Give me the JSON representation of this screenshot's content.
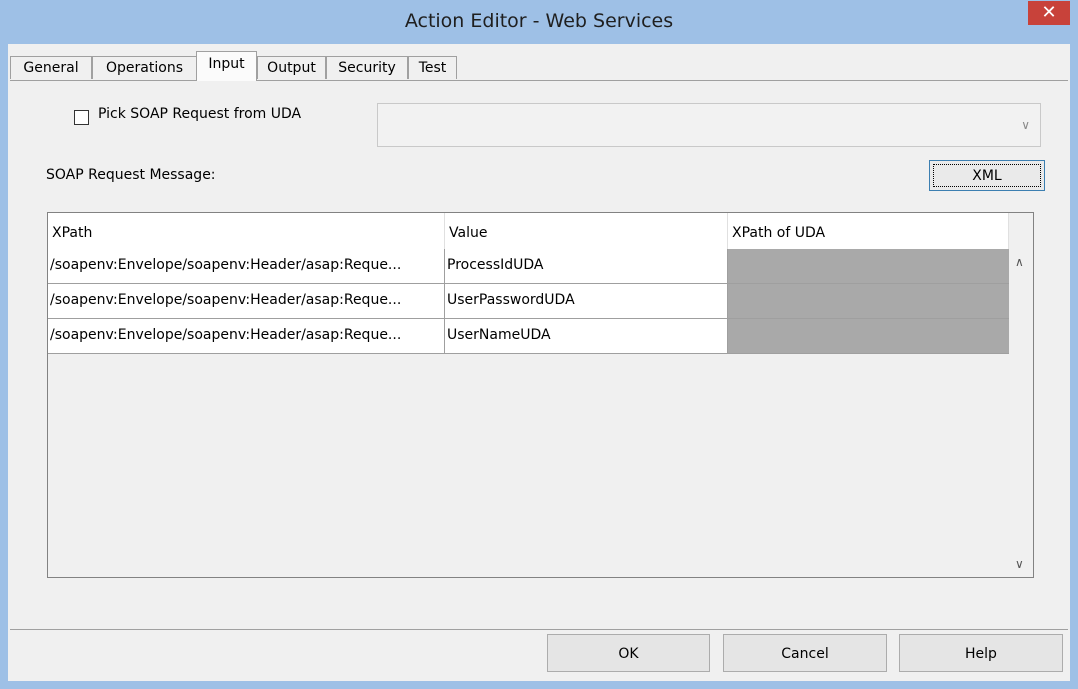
{
  "window": {
    "title": "Action Editor - Web Services",
    "close_glyph": "✕"
  },
  "tabs": [
    {
      "label": "General"
    },
    {
      "label": "Operations"
    },
    {
      "label": "Input"
    },
    {
      "label": "Output"
    },
    {
      "label": "Security"
    },
    {
      "label": "Test"
    }
  ],
  "active_tab": "Input",
  "input": {
    "pick_soap_label": "Pick SOAP Request from UDA",
    "pick_soap_checked": false,
    "uda_select_value": "",
    "soap_message_label": "SOAP Request Message:",
    "xml_button": "XML"
  },
  "grid": {
    "columns": [
      "XPath",
      "Value",
      "XPath of UDA"
    ],
    "rows": [
      {
        "xpath": "/soapenv:Envelope/soapenv:Header/asap:Reque...",
        "value": "ProcessIdUDA",
        "uda": ""
      },
      {
        "xpath": "/soapenv:Envelope/soapenv:Header/asap:Reque...",
        "value": "UserPasswordUDA",
        "uda": ""
      },
      {
        "xpath": "/soapenv:Envelope/soapenv:Header/asap:Reque...",
        "value": "UserNameUDA",
        "uda": ""
      }
    ]
  },
  "buttons": {
    "ok": "OK",
    "cancel": "Cancel",
    "help": "Help"
  },
  "icons": {
    "scroll_up": "chevron-up-icon",
    "scroll_down": "chevron-down-icon",
    "dropdown": "chevron-down-icon"
  },
  "colors": {
    "titlebar": "#9ec0e6",
    "close": "#c8423a",
    "uda_cell": "#a9a9a9"
  }
}
